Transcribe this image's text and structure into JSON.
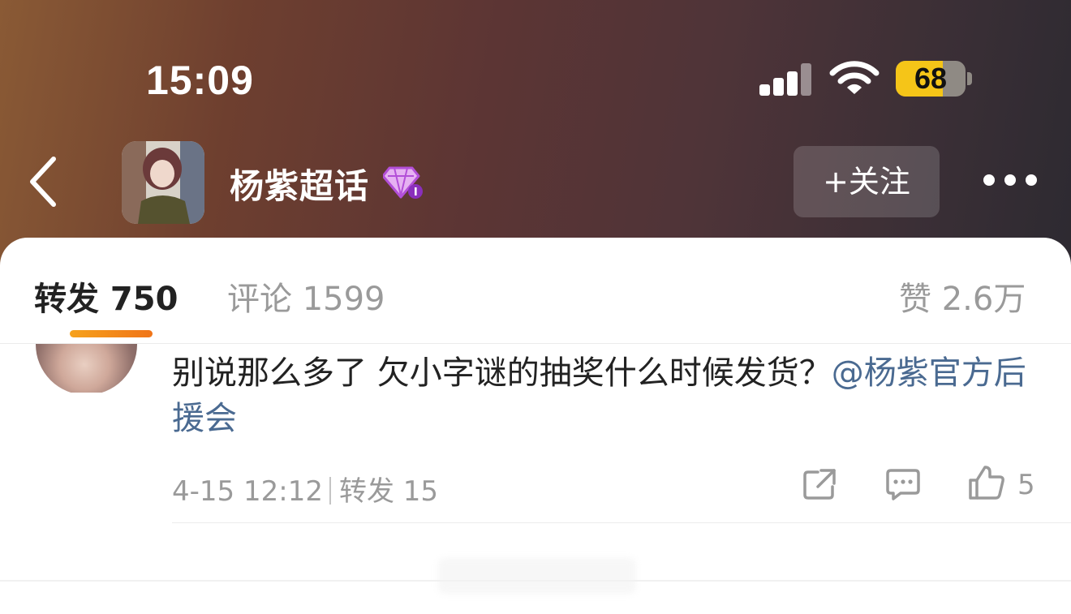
{
  "status_bar": {
    "time": "15:09",
    "battery": "68",
    "battery_level": 0.68,
    "icons": [
      "signal-icon",
      "wifi-icon",
      "battery-icon"
    ]
  },
  "header": {
    "title": "杨紫超话",
    "follow_label": "+关注",
    "icons": [
      "back-icon",
      "diamond-badge-icon",
      "more-icon"
    ]
  },
  "tabs": {
    "repost": "转发 750",
    "comment": "评论 1599",
    "like": "赞 2.6万",
    "active": "repost"
  },
  "comment": {
    "text": "别说那么多了 欠小字谜的抽奖什么时候发货？",
    "mention": "@杨紫官方后援会",
    "date": "4-15 12:12",
    "repost_label": "转发 15",
    "like_count": "5",
    "icons": [
      "share-icon",
      "comment-icon",
      "thumbs-up-icon"
    ]
  },
  "colors": {
    "accent": "#f07418",
    "link": "#4a6a91",
    "battery": "#f5c518"
  }
}
